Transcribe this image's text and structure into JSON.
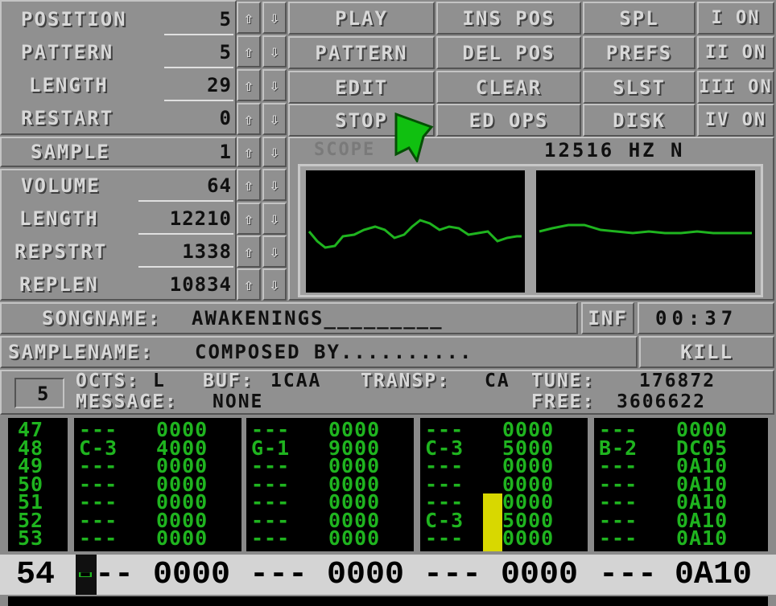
{
  "song_panel": {
    "position": {
      "label": "POSITION",
      "value": "5"
    },
    "pattern": {
      "label": "PATTERN",
      "value": "5"
    },
    "length": {
      "label": "LENGTH",
      "value": "29"
    },
    "restart": {
      "label": "RESTART",
      "value": "0"
    }
  },
  "buttons": {
    "play": "PLAY",
    "pattern": "PATTERN",
    "edit": "EDIT",
    "stop": "STOP",
    "ins_pos": "INS POS",
    "del_pos": "DEL POS",
    "clear": "CLEAR",
    "ed_ops": "ED OPS",
    "spl": "SPL",
    "prefs": "PREFS",
    "slst": "SLST",
    "disk": "DISK",
    "ch1": "I ON",
    "ch2": "II ON",
    "ch3": "III ON",
    "ch4": "IV ON",
    "inf": "INF",
    "kill": "KILL"
  },
  "sample_panel": {
    "sample": {
      "label": "SAMPLE",
      "value": "1"
    },
    "volume": {
      "label": "VOLUME",
      "value": "64"
    },
    "length": {
      "label": "LENGTH",
      "value": "12210"
    },
    "repstrt": {
      "label": "REPSTRT",
      "value": "1338"
    },
    "replen": {
      "label": "REPLEN",
      "value": "10834"
    }
  },
  "scope": {
    "label": "SCOPE",
    "frequency": "12516 HZ N"
  },
  "songname": {
    "label": "SONGNAME:",
    "value": "AWAKENINGS_________"
  },
  "timer": "00:37",
  "samplename": {
    "label": "SAMPLENAME:",
    "value": "COMPOSED BY.........."
  },
  "status": {
    "octave_box": "5",
    "octs": "OCTS:",
    "octs_value": "L",
    "buf": "BUF:",
    "buf_value": "1CAA",
    "transp": "TRANSP:",
    "transp_value": "CA",
    "tune": "TUNE:",
    "tune_value": "176872",
    "message": "MESSAGE:",
    "message_value": "NONE",
    "free": "FREE:",
    "free_value": "3606622"
  },
  "pattern_editor": {
    "row_numbers": [
      "47",
      "48",
      "49",
      "50",
      "51",
      "52",
      "53"
    ],
    "tracks": [
      {
        "notes": [
          "---",
          "C-3",
          "---",
          "---",
          "---",
          "---",
          "---"
        ],
        "cmds": [
          "0000",
          "4000",
          "0000",
          "0000",
          "0000",
          "0000",
          "0000"
        ]
      },
      {
        "notes": [
          "---",
          "G-1",
          "---",
          "---",
          "---",
          "---",
          "---"
        ],
        "cmds": [
          "0000",
          "9000",
          "0000",
          "0000",
          "0000",
          "0000",
          "0000"
        ]
      },
      {
        "notes": [
          "---",
          "C-3",
          "---",
          "---",
          "---",
          "C-3",
          "---"
        ],
        "cmds": [
          "0000",
          "5000",
          "0000",
          "0000",
          "0000",
          "5000",
          "0000"
        ]
      },
      {
        "notes": [
          "---",
          "B-2",
          "---",
          "---",
          "---",
          "---",
          "---"
        ],
        "cmds": [
          "0000",
          "DC05",
          "0A10",
          "0A10",
          "0A10",
          "0A10",
          "0A10"
        ]
      }
    ],
    "current_row": {
      "number": "54",
      "tracks": [
        {
          "note": "---",
          "cmd": "0000"
        },
        {
          "note": "---",
          "cmd": "0000"
        },
        {
          "note": "---",
          "cmd": "0000"
        },
        {
          "note": "---",
          "cmd": "0A10"
        }
      ]
    }
  },
  "colors": {
    "panel": "#909090",
    "tracker_green": "#1fb41f",
    "cursor_yellow": "#d8d800",
    "pointer_green": "#10c010"
  }
}
